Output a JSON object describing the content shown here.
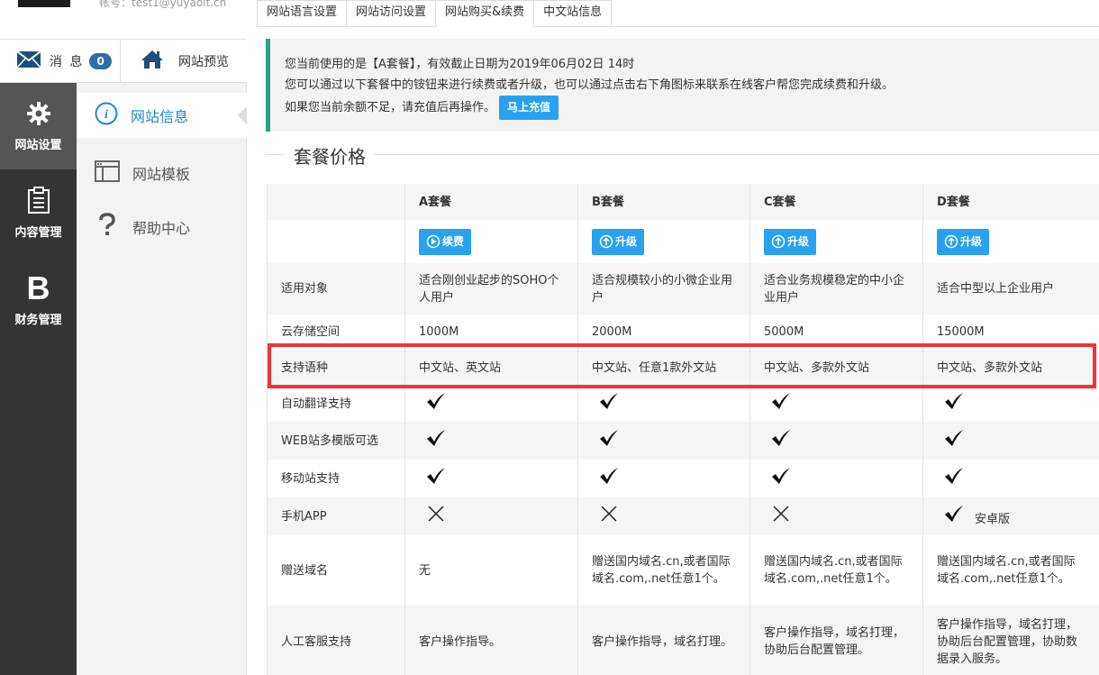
{
  "header": {
    "account": "帐号：test1@yuyaoit.cn",
    "messages_label": "消 息",
    "messages_count": "0",
    "preview_label": "网站预览"
  },
  "sidebar": {
    "items": [
      {
        "label": "网站设置",
        "icon": "gear-icon"
      },
      {
        "label": "内容管理",
        "icon": "clipboard-icon"
      },
      {
        "label": "财务管理",
        "icon": "b-letter-icon",
        "glyph": "B"
      }
    ]
  },
  "submenu": {
    "items": [
      {
        "label": "网站信息",
        "icon": "info-icon"
      },
      {
        "label": "网站模板",
        "icon": "template-icon"
      },
      {
        "label": "帮助中心",
        "icon": "question-icon"
      }
    ]
  },
  "tabs": [
    "网站语言设置",
    "网站访问设置",
    "网站购买&续费",
    "中文站信息"
  ],
  "notice": {
    "line1": "您当前使用的是【A套餐】，有效截止日期为2019年06月02日 14时",
    "line2": "您可以通过以下套餐中的铵钮来进行续费或者升级，也可以通过点击右下角图标来联系在线客户帮您完成续费和升级。",
    "line3": "如果您当前余额不足，请充值后再操作。",
    "charge_button": "马上充值"
  },
  "section_title": "套餐价格",
  "table": {
    "plans": [
      "A套餐",
      "B套餐",
      "C套餐",
      "D套餐"
    ],
    "actions": [
      "续费",
      "升级",
      "升级",
      "升级"
    ],
    "rows": {
      "target": {
        "label": "适用对象",
        "values": [
          "适合刚创业起步的SOHO个人用户",
          "适合规模较小的小微企业用户",
          "适合业务规模稳定的中小企业用户",
          "适合中型以上企业用户"
        ]
      },
      "storage": {
        "label": "云存储空间",
        "values": [
          "1000M",
          "2000M",
          "5000M",
          "15000M"
        ]
      },
      "languages": {
        "label": "支持语种",
        "values": [
          "中文站、英文站",
          "中文站、任意1款外文站",
          "中文站、多款外文站",
          "中文站、多款外文站"
        ]
      },
      "translate": {
        "label": "自动翻译支持"
      },
      "templates": {
        "label": "WEB站多模版可选"
      },
      "mobile": {
        "label": "移动站支持"
      },
      "app": {
        "label": "手机APP",
        "d_note": "安卓版"
      },
      "domain": {
        "label": "赠送域名",
        "values": [
          "无",
          "赠送国内域名.cn,或者国际域名.com,.net任意1个。",
          "赠送国内域名.cn,或者国际域名.com,.net任意1个。",
          "赠送国内域名.cn,或者国际域名.com,.net任意1个。"
        ]
      },
      "support": {
        "label": "人工客服支持",
        "values": [
          "客户操作指导。",
          "客户操作指导，域名打理。",
          "客户操作指导，域名打理，协助后台配置管理。",
          "客户操作指导，域名打理，协助后台配置管理，协助数据录入服务。"
        ]
      }
    }
  },
  "colors": {
    "accent": "#28a1f0",
    "sidebar_bg": "#333437",
    "highlight": "#f2323a",
    "notice_border": "#2f9f87"
  }
}
